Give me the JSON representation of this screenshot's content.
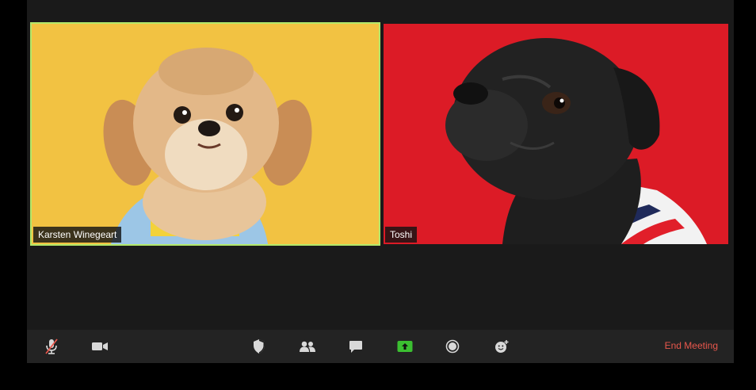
{
  "participants": [
    {
      "name": "Karsten Winegeart",
      "background": "#f2c242",
      "active_speaker": true
    },
    {
      "name": "Toshi",
      "background": "#dc1b26",
      "active_speaker": false
    }
  ],
  "toolbar": {
    "end_label": "End Meeting",
    "icons": [
      "microphone-muted-icon",
      "video-camera-icon",
      "shield-icon",
      "participants-icon",
      "chat-icon",
      "share-screen-icon",
      "record-icon",
      "reactions-icon"
    ]
  },
  "colors": {
    "active_speaker_border": "#b3e86a",
    "share_green": "#3bbf31",
    "end_meeting": "#e8574c",
    "mute_slash": "#e8574c"
  }
}
